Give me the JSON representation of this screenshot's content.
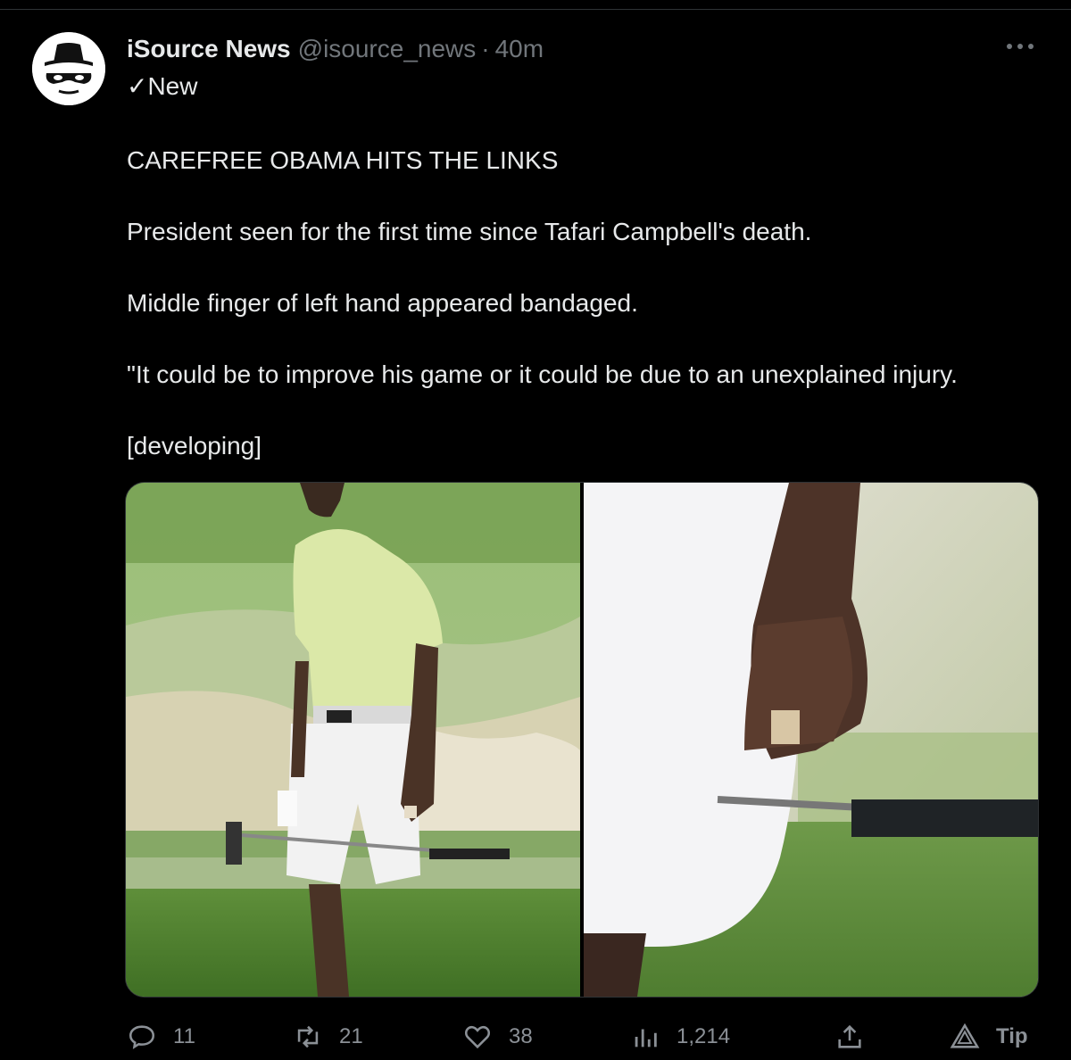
{
  "tweet": {
    "display_name": "iSource News",
    "handle": "@isource_news",
    "separator": "·",
    "time": "40m",
    "badge": "✓New",
    "more_icon": "more-dots-icon",
    "text": {
      "headline": "CAREFREE OBAMA HITS THE LINKS",
      "line1": "President seen for the first time since Tafari Campbell's death.",
      "line2": "Middle finger of left hand appeared bandaged.",
      "line3": "\"It could be to improve his game or it could be due to an unexplained injury.",
      "line4": "[developing]"
    }
  },
  "actions": {
    "replies": "11",
    "retweets": "21",
    "likes": "38",
    "views": "1,214",
    "tip_label": "Tip"
  },
  "colors": {
    "background": "#000000",
    "text": "#e7e9ea",
    "muted": "#71767b",
    "border": "#2f3336"
  }
}
